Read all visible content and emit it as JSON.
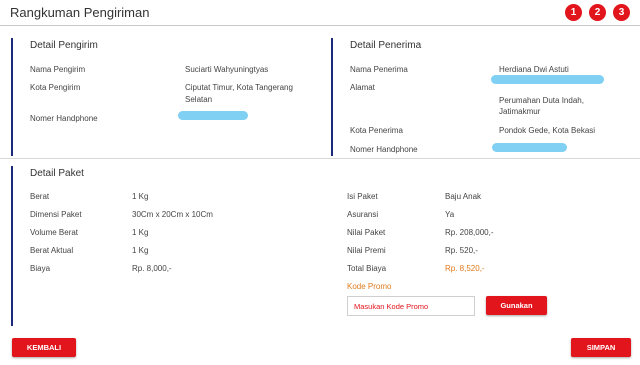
{
  "header": {
    "title": "Rangkuman Pengiriman",
    "steps": [
      "1",
      "2",
      "3"
    ]
  },
  "sender": {
    "title": "Detail Pengirim",
    "name_label": "Nama Pengirim",
    "name_value": "Suciarti Wahyuningtyas",
    "city_label": "Kota Pengirim",
    "city_value_line1": "Ciputat Timur, Kota Tangerang",
    "city_value_line2": "Selatan",
    "phone_label": "Nomer Handphone"
  },
  "receiver": {
    "title": "Detail Penerima",
    "name_label": "Nama Penerima",
    "name_value": "Herdiana Dwi Astuti",
    "address_label": "Alamat",
    "address_line1": "Perumahan Duta Indah,",
    "address_line2": "Jatimakmur",
    "city_label": "Kota Penerima",
    "city_value": "Pondok Gede, Kota Bekasi",
    "phone_label": "Nomer Handphone"
  },
  "package": {
    "title": "Detail Paket",
    "left": [
      {
        "label": "Berat",
        "value": "1 Kg"
      },
      {
        "label": "Dimensi Paket",
        "value": "30Cm x 20Cm x 10Cm"
      },
      {
        "label": "Volume Berat",
        "value": "1 Kg"
      },
      {
        "label": "Berat Aktual",
        "value": "1 Kg"
      },
      {
        "label": "Biaya",
        "value": "Rp. 8,000,-"
      }
    ],
    "right": [
      {
        "label": "Isi Paket",
        "value": "Baju Anak"
      },
      {
        "label": "Asuransi",
        "value": "Ya"
      },
      {
        "label": "Nilai Paket",
        "value": "Rp. 208,000,-"
      },
      {
        "label": "Nilai Premi",
        "value": "Rp. 520,-"
      },
      {
        "label": "Total Biaya",
        "value": "Rp. 8,520,-"
      }
    ],
    "promo_label": "Kode Promo",
    "promo_placeholder": "Masukan Kode Promo",
    "apply_button": "Gunakan"
  },
  "footer": {
    "back_button": "KEMBALI",
    "save_button": "SIMPAN"
  },
  "colors": {
    "accent_red": "#e2141c",
    "section_bar": "#1b2a7a",
    "highlight_orange": "#e07b1c",
    "redaction_blue": "#7fd0f2"
  }
}
